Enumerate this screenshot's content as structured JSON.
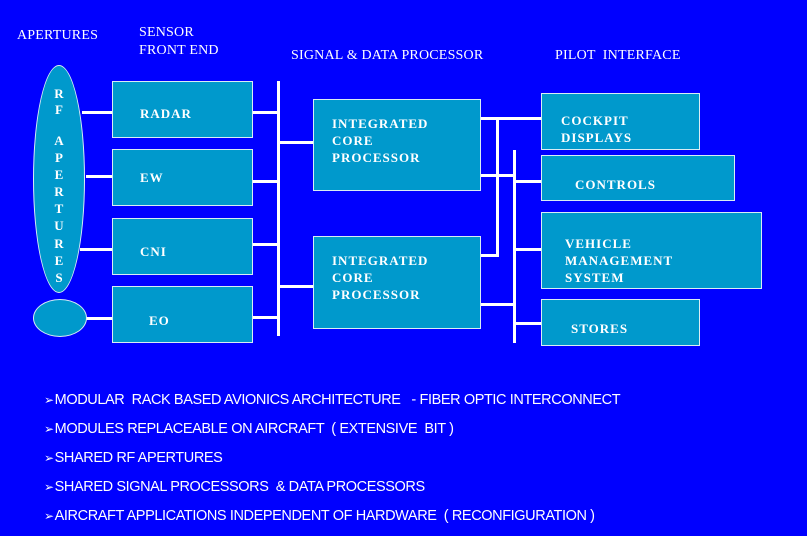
{
  "colors": {
    "background": "#0000ff",
    "box_fill": "#0099cc",
    "box_border": "#d8ecf5",
    "text": "#ffffff",
    "connector": "#ffffff"
  },
  "headers": {
    "apertures": "APERTURES",
    "sensor_front_end": "SENSOR\nFRONT END",
    "signal_data_processor": "SIGNAL & DATA PROCESSOR",
    "pilot_interface": "PILOT  INTERFACE"
  },
  "apertures": {
    "rf_letters": [
      "R",
      "F",
      "",
      "A",
      "P",
      "E",
      "R",
      "T",
      "U",
      "R",
      "E",
      "S"
    ],
    "eo_aperture_label": ""
  },
  "sensors": [
    "RADAR",
    "EW",
    "CNI",
    "EO"
  ],
  "processors": [
    "INTEGRATED\nCORE\nPROCESSOR",
    "INTEGRATED\nCORE\nPROCESSOR"
  ],
  "pilot_interface": [
    "COCKPIT\nDISPLAYS",
    "CONTROLS",
    "VEHICLE\nMANAGEMENT\nSYSTEM",
    "STORES"
  ],
  "bullet_marker": "➢",
  "bullets": [
    "MODULAR  RACK BASED AVIONICS ARCHITECTURE   - FIBER OPTIC INTERCONNECT",
    "MODULES REPLACEABLE ON AIRCRAFT  ( EXTENSIVE  BIT )",
    "SHARED RF APERTURES",
    "SHARED SIGNAL PROCESSORS  & DATA PROCESSORS",
    "AIRCRAFT APPLICATIONS INDEPENDENT OF HARDWARE  ( RECONFIGURATION )"
  ]
}
